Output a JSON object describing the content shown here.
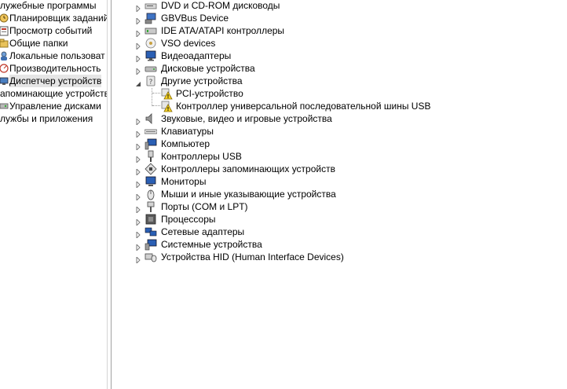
{
  "left_nav": {
    "items": [
      {
        "label": "лужебные программы",
        "icon": "tools-folder-icon"
      },
      {
        "label": "Планировщик заданий",
        "icon": "task-scheduler-icon"
      },
      {
        "label": "Просмотр событий",
        "icon": "event-viewer-icon"
      },
      {
        "label": "Общие папки",
        "icon": "shared-folders-icon"
      },
      {
        "label": "Локальные пользоват",
        "icon": "local-users-icon"
      },
      {
        "label": "Производительность",
        "icon": "performance-icon"
      },
      {
        "label": "Диспетчер устройств",
        "icon": "device-manager-icon",
        "selected": true
      },
      {
        "label": "апоминающие устройств",
        "icon": "storage-folder-icon"
      },
      {
        "label": "Управление дисками",
        "icon": "disk-management-icon"
      },
      {
        "label": "лужбы и приложения",
        "icon": "services-folder-icon"
      }
    ]
  },
  "device_tree": {
    "items": [
      {
        "label": "DVD и CD-ROM дисководы",
        "icon": "dvd-drive-icon",
        "state": "collapsed"
      },
      {
        "label": "GBVBus Device",
        "icon": "bus-device-icon",
        "state": "collapsed"
      },
      {
        "label": "IDE ATA/ATAPI контроллеры",
        "icon": "ide-controller-icon",
        "state": "collapsed"
      },
      {
        "label": "VSO devices",
        "icon": "vso-device-icon",
        "state": "collapsed"
      },
      {
        "label": "Видеоадаптеры",
        "icon": "display-adapter-icon",
        "state": "collapsed"
      },
      {
        "label": "Дисковые устройства",
        "icon": "disk-drive-icon",
        "state": "collapsed"
      },
      {
        "label": "Другие устройства",
        "icon": "unknown-device-icon",
        "state": "expanded"
      },
      {
        "label": "PCI-устройство",
        "icon": "warning-device-icon",
        "state": "child"
      },
      {
        "label": "Контроллер универсальной последовательной шины USB",
        "icon": "warning-device-icon",
        "state": "child"
      },
      {
        "label": "Звуковые, видео и игровые устройства",
        "icon": "speaker-icon",
        "state": "collapsed"
      },
      {
        "label": "Клавиатуры",
        "icon": "keyboard-icon",
        "state": "collapsed"
      },
      {
        "label": "Компьютер",
        "icon": "computer-icon",
        "state": "collapsed"
      },
      {
        "label": "Контроллеры USB",
        "icon": "usb-controller-icon",
        "state": "collapsed"
      },
      {
        "label": "Контроллеры запоминающих устройств",
        "icon": "storage-controller-icon",
        "state": "collapsed"
      },
      {
        "label": "Мониторы",
        "icon": "monitor-icon",
        "state": "collapsed"
      },
      {
        "label": "Мыши и иные указывающие устройства",
        "icon": "mouse-icon",
        "state": "collapsed"
      },
      {
        "label": "Порты (COM и LPT)",
        "icon": "port-icon",
        "state": "collapsed"
      },
      {
        "label": "Процессоры",
        "icon": "processor-icon",
        "state": "collapsed"
      },
      {
        "label": "Сетевые адаптеры",
        "icon": "network-adapter-icon",
        "state": "collapsed"
      },
      {
        "label": "Системные устройства",
        "icon": "system-device-icon",
        "state": "collapsed"
      },
      {
        "label": "Устройства HID (Human Interface Devices)",
        "icon": "hid-device-icon",
        "state": "collapsed"
      }
    ]
  },
  "colors": {
    "selection": "#e5e5e5",
    "warning_yellow": "#f5d327",
    "expander": "#7a7a7a",
    "splitter": "#a0a0a0"
  }
}
